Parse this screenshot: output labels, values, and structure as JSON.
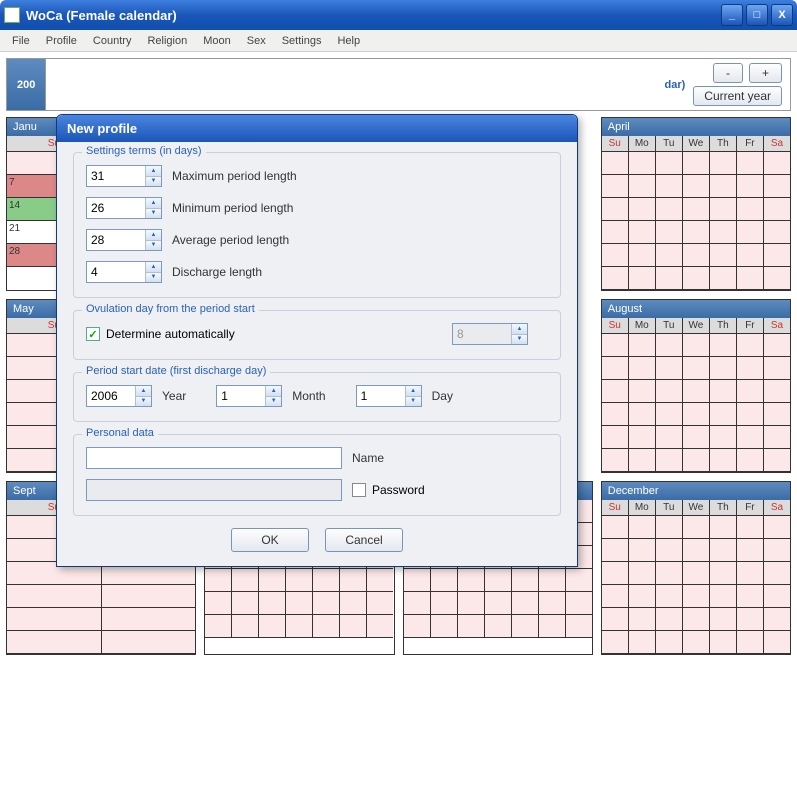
{
  "window": {
    "title": "WoCa (Female calendar)",
    "minimize": "_",
    "maximize": "□",
    "close": "X"
  },
  "menubar": [
    "File",
    "Profile",
    "Country",
    "Religion",
    "Moon",
    "Sex",
    "Settings",
    "Help"
  ],
  "toprow": {
    "year_tab": "200",
    "center_text": "dar)",
    "minus": "-",
    "plus": "+",
    "current_year": "Current year"
  },
  "dow": [
    "Su",
    "Mo",
    "Tu",
    "We",
    "Th",
    "Fr",
    "Sa"
  ],
  "months": {
    "row1": [
      "Janu",
      "",
      "",
      "April"
    ],
    "row2": [
      "May",
      "",
      "",
      "August"
    ],
    "row3": [
      "Sept",
      "",
      "",
      "December"
    ]
  },
  "left_days": [
    "7",
    "14",
    "21",
    "28"
  ],
  "dialog": {
    "title": "New profile",
    "groups": {
      "settings_terms": {
        "legend": "Settings terms (in days)",
        "max_period": {
          "value": "31",
          "label": "Maximum period length"
        },
        "min_period": {
          "value": "26",
          "label": "Minimum period length"
        },
        "avg_period": {
          "value": "28",
          "label": "Average period length"
        },
        "discharge": {
          "value": "4",
          "label": "Discharge length"
        }
      },
      "ovulation": {
        "legend": "Ovulation day from the period start",
        "auto_label": "Determine automatically",
        "auto_checked": true,
        "day_value": "8"
      },
      "period_start": {
        "legend": "Period start date (first discharge day)",
        "year": {
          "value": "2006",
          "label": "Year"
        },
        "month": {
          "value": "1",
          "label": "Month"
        },
        "day": {
          "value": "1",
          "label": "Day"
        }
      },
      "personal": {
        "legend": "Personal data",
        "name_label": "Name",
        "password_label": "Password",
        "password_checked": false
      }
    },
    "buttons": {
      "ok": "OK",
      "cancel": "Cancel"
    }
  }
}
